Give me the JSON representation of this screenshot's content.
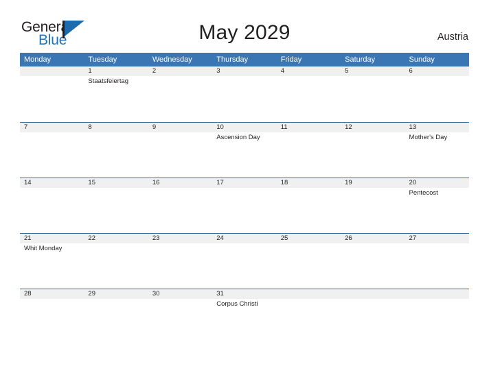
{
  "brand": {
    "name_part1": "General",
    "name_part2": "Blue",
    "mark_icon": "flag-triangle-icon"
  },
  "header": {
    "title": "May 2029",
    "region": "Austria"
  },
  "colors": {
    "header_blue": "#3b76b4",
    "rule_blue": "#2e6da4",
    "number_band": "#f0f0f0",
    "brand_blue": "#1e74bb",
    "text": "#231f20"
  },
  "calendar": {
    "weekdays": [
      "Monday",
      "Tuesday",
      "Wednesday",
      "Thursday",
      "Friday",
      "Saturday",
      "Sunday"
    ],
    "weeks": [
      [
        {
          "day": "",
          "event": ""
        },
        {
          "day": "1",
          "event": "Staatsfeiertag"
        },
        {
          "day": "2",
          "event": ""
        },
        {
          "day": "3",
          "event": ""
        },
        {
          "day": "4",
          "event": ""
        },
        {
          "day": "5",
          "event": ""
        },
        {
          "day": "6",
          "event": ""
        }
      ],
      [
        {
          "day": "7",
          "event": ""
        },
        {
          "day": "8",
          "event": ""
        },
        {
          "day": "9",
          "event": ""
        },
        {
          "day": "10",
          "event": "Ascension Day"
        },
        {
          "day": "11",
          "event": ""
        },
        {
          "day": "12",
          "event": ""
        },
        {
          "day": "13",
          "event": "Mother's Day"
        }
      ],
      [
        {
          "day": "14",
          "event": ""
        },
        {
          "day": "15",
          "event": ""
        },
        {
          "day": "16",
          "event": ""
        },
        {
          "day": "17",
          "event": ""
        },
        {
          "day": "18",
          "event": ""
        },
        {
          "day": "19",
          "event": ""
        },
        {
          "day": "20",
          "event": "Pentecost"
        }
      ],
      [
        {
          "day": "21",
          "event": "Whit Monday"
        },
        {
          "day": "22",
          "event": ""
        },
        {
          "day": "23",
          "event": ""
        },
        {
          "day": "24",
          "event": ""
        },
        {
          "day": "25",
          "event": ""
        },
        {
          "day": "26",
          "event": ""
        },
        {
          "day": "27",
          "event": ""
        }
      ],
      [
        {
          "day": "28",
          "event": ""
        },
        {
          "day": "29",
          "event": ""
        },
        {
          "day": "30",
          "event": ""
        },
        {
          "day": "31",
          "event": "Corpus Christi"
        },
        {
          "day": "",
          "event": ""
        },
        {
          "day": "",
          "event": ""
        },
        {
          "day": "",
          "event": ""
        }
      ]
    ]
  }
}
